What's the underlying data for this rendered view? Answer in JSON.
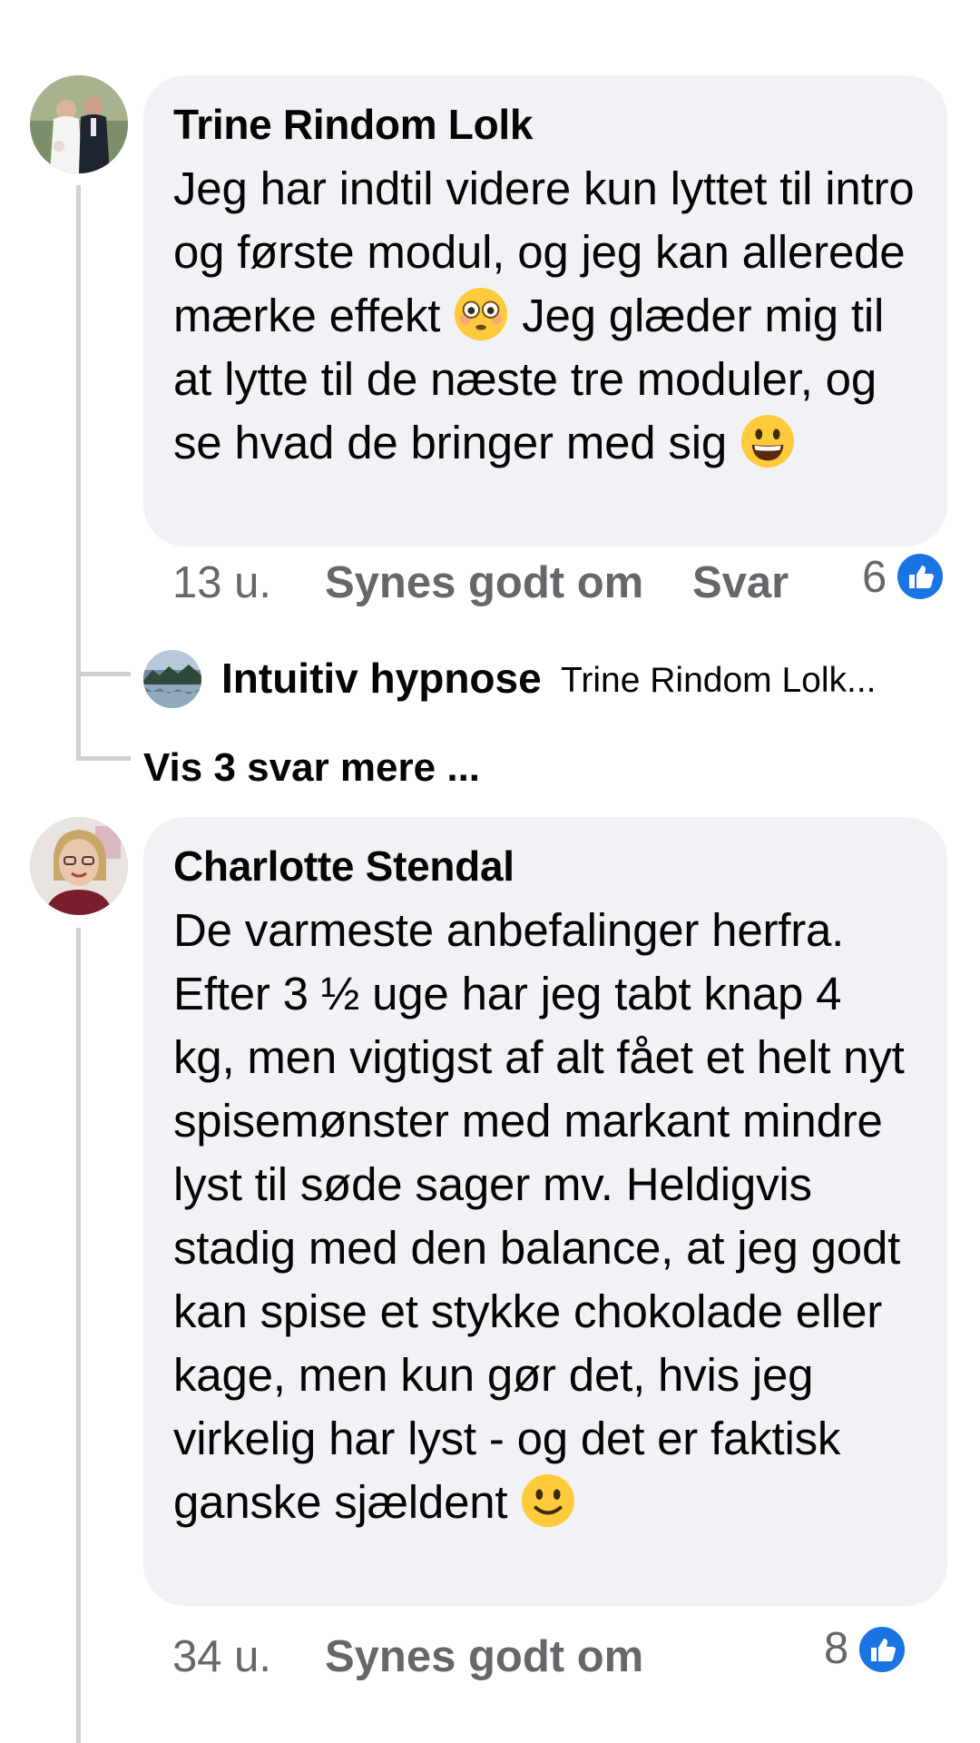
{
  "comments": [
    {
      "author": "Trine Rindom Lolk",
      "text_part1": "Jeg har indtil videre kun lyttet til intro og første modul, og jeg kan allerede mærke effekt ",
      "emoji1": "flushed-face-emoji",
      "text_part2": " Jeg glæder mig til at lytte til de næste tre moduler, og se hvad de bringer med sig ",
      "emoji2": "grinning-face-emoji",
      "time": "13 u.",
      "like_label": "Synes godt om",
      "reply_label": "Svar",
      "like_count": "6",
      "like_icon": "thumbs-up-icon"
    },
    {
      "author": "Charlotte Stendal",
      "text_part1": "De varmeste anbefalinger herfra. Efter 3 ½ uge har jeg tabt knap 4 kg, men vigtigst af alt fået et helt nyt spisemønster med markant mindre lyst til søde sager mv. Heldigvis stadig med den balance, at jeg godt kan spise et stykke chokolade eller kage, men kun gør det, hvis jeg virkelig har lyst - og det er faktisk ganske sjældent ",
      "emoji1": "slightly-smiling-face-emoji",
      "time": "34 u.",
      "like_label": "Synes godt om",
      "like_count": "8",
      "like_icon": "thumbs-up-icon"
    }
  ],
  "reply_preview": {
    "author": "Intuitiv hypnose",
    "text": "Trine Rindom Lolk..."
  },
  "more_replies": "Vis 3 svar mere ...",
  "colors": {
    "bubble": "#f0f2f5",
    "secondary_text": "#65676b",
    "like_blue": "#1b74e4",
    "thread_line": "#ced0d4"
  }
}
